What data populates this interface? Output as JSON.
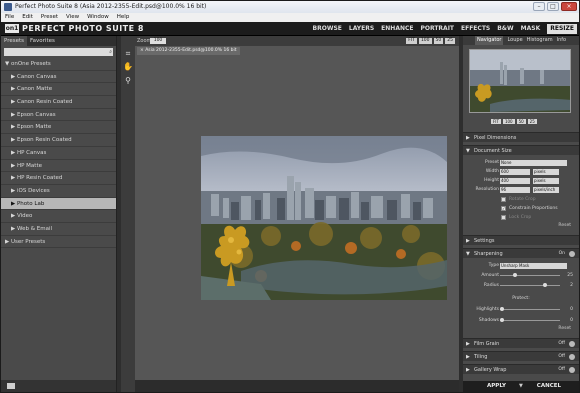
{
  "window": {
    "title": "Perfect Photo Suite 8 (Asia 2012-2355-Edit.psd@100.0% 16 bit)",
    "controls": [
      "–",
      "□",
      "×"
    ]
  },
  "menu": [
    "File",
    "Edit",
    "Preset",
    "View",
    "Window",
    "Help"
  ],
  "app": {
    "logo_mark": "on1",
    "logo_name": "PERFECT PHOTO SUITE 8",
    "modes": [
      "BROWSE",
      "LAYERS",
      "ENHANCE",
      "PORTRAIT",
      "EFFECTS",
      "B&W",
      "MASK",
      "RESIZE"
    ],
    "active_mode": "RESIZE"
  },
  "left_panel": {
    "tabs": [
      "Presets",
      "Favorites"
    ],
    "search_placeholder": "",
    "items": [
      {
        "label": "▼ onOne Presets",
        "type": "head"
      },
      {
        "label": "▶  Canon Canvas",
        "type": "item"
      },
      {
        "label": "▶  Canon Matte",
        "type": "item"
      },
      {
        "label": "▶  Canon Resin Coated",
        "type": "item"
      },
      {
        "label": "▶  Epson Canvas",
        "type": "item"
      },
      {
        "label": "▶  Epson Matte",
        "type": "item"
      },
      {
        "label": "▶  Epson Resin Coated",
        "type": "item"
      },
      {
        "label": "▶  HP Canvas",
        "type": "item"
      },
      {
        "label": "▶  HP Matte",
        "type": "item"
      },
      {
        "label": "▶  HP Resin Coated",
        "type": "item"
      },
      {
        "label": "▶  iOS Devices",
        "type": "item"
      },
      {
        "label": "▶  Photo Lab",
        "type": "sel"
      },
      {
        "label": "▶  Video",
        "type": "item"
      },
      {
        "label": "▶  Web & Email",
        "type": "item"
      },
      {
        "label": "▶ User Presets",
        "type": "head"
      }
    ]
  },
  "canvas": {
    "zoom_label": "Zoom",
    "zoom_value": "100",
    "fit_buttons": [
      "FIT",
      "100",
      "50",
      "25"
    ],
    "doc_tab": "×  Asia 2012-2355-Edit.psd@100.0% 16 bit"
  },
  "right_panel": {
    "nav_tabs": [
      "Navigator",
      "Loupe",
      "Histogram",
      "Info"
    ],
    "thumb_buttons": [
      "FIT",
      "100",
      "50",
      "25"
    ],
    "sections": {
      "pixel_dimensions": "Pixel Dimensions",
      "document_size": "Document Size",
      "settings": "Settings",
      "sharpening": "Sharpening",
      "film_grain": "Film Grain",
      "tiling": "Tiling",
      "gallery_wrap": "Gallery Wrap"
    },
    "doc": {
      "preset_label": "Preset",
      "preset_value": "None",
      "width_label": "Width",
      "width_value": "600",
      "width_unit": "pixels",
      "height_label": "Height",
      "height_value": "400",
      "height_unit": "pixels",
      "res_label": "Resolution",
      "res_value": "96",
      "res_unit": "pixels/inch",
      "rotate_label": "Rotate Crop",
      "constrain_label": "Constrain Proportions",
      "lock_label": "Lock Crop",
      "reset": "Reset"
    },
    "sharp": {
      "state": "On",
      "type_label": "Type",
      "type_value": "Unsharp Mask",
      "amount_label": "Amount",
      "amount_value": "25",
      "radius_label": "Radius",
      "radius_value": "2",
      "protect_label": "Protect:",
      "highlights_label": "Highlights",
      "highlights_value": "0",
      "shadows_label": "Shadows",
      "shadows_value": "0",
      "reset": "Reset"
    },
    "states": {
      "film_grain": "Off",
      "tiling": "Off",
      "gallery_wrap": "Off",
      "settings": ""
    },
    "apply": "APPLY",
    "cancel": "CANCEL",
    "apply_menu": "▼"
  }
}
